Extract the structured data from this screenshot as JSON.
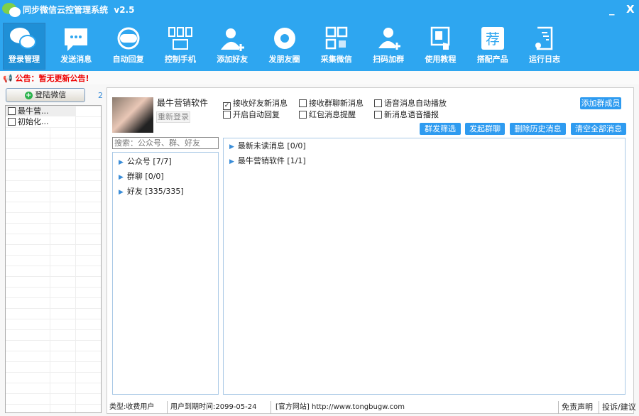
{
  "app": {
    "title": "同步微信云控管理系统",
    "version": "v2.5",
    "minimize": "_",
    "close": "X"
  },
  "toolbar": [
    {
      "label": "登录管理",
      "icon": "chat-bubbles-icon",
      "selected": true
    },
    {
      "label": "发送消息",
      "icon": "message-icon"
    },
    {
      "label": "自动回复",
      "icon": "robot-headset-icon"
    },
    {
      "label": "控制手机",
      "icon": "devices-icon"
    },
    {
      "label": "添加好友",
      "icon": "add-user-icon"
    },
    {
      "label": "发朋友圈",
      "icon": "aperture-icon"
    },
    {
      "label": "采集微信",
      "icon": "qrcode-icon"
    },
    {
      "label": "扫码加群",
      "icon": "add-group-icon"
    },
    {
      "label": "使用教程",
      "icon": "tutorial-icon"
    },
    {
      "label": "搭配产品",
      "icon": "recommend-icon",
      "glyph": "荐"
    },
    {
      "label": "运行日志",
      "icon": "log-icon"
    }
  ],
  "notice": "公告：暂无更新公告!",
  "left": {
    "login_button": "登陆微信",
    "count": "2",
    "accounts": [
      {
        "name": "最牛营...",
        "checked": false
      },
      {
        "name": "初始化...",
        "checked": false
      }
    ]
  },
  "profile": {
    "name": "最牛营销软件",
    "relogin": "重新登录"
  },
  "options": [
    {
      "label": "接收好友新消息",
      "checked": true
    },
    {
      "label": "接收群聊新消息",
      "checked": false
    },
    {
      "label": "语音消息自动播放",
      "checked": false
    },
    {
      "label": "开启自动回复",
      "checked": false
    },
    {
      "label": "红包消息提醒",
      "checked": false
    },
    {
      "label": "新消息语音播报",
      "checked": false
    }
  ],
  "buttons": {
    "add_member": "添加群成员",
    "filter": "群发筛选",
    "start_group": "发起群聊",
    "delete_history": "删除历史消息",
    "clear_all": "清空全部消息"
  },
  "search": {
    "placeholder": "搜索：公众号、群、好友"
  },
  "contacts": [
    {
      "label": "公众号 [7/7]"
    },
    {
      "label": "群聊 [0/0]"
    },
    {
      "label": "好友 [335/335]"
    }
  ],
  "messages": [
    {
      "label": "最新未读消息 [0/0]"
    },
    {
      "label": "最牛营销软件 [1/1]"
    }
  ],
  "status": {
    "type": "类型:收费用户",
    "expiry": "用户到期时间:2099-05-24",
    "website": "[官方网站] http://www.tongbugw.com",
    "disclaimer": "免责声明",
    "feedback": "投诉/建议"
  },
  "colors": {
    "brand": "#2ea6f0",
    "button": "#2e9bf0",
    "notice": "#e00000"
  }
}
